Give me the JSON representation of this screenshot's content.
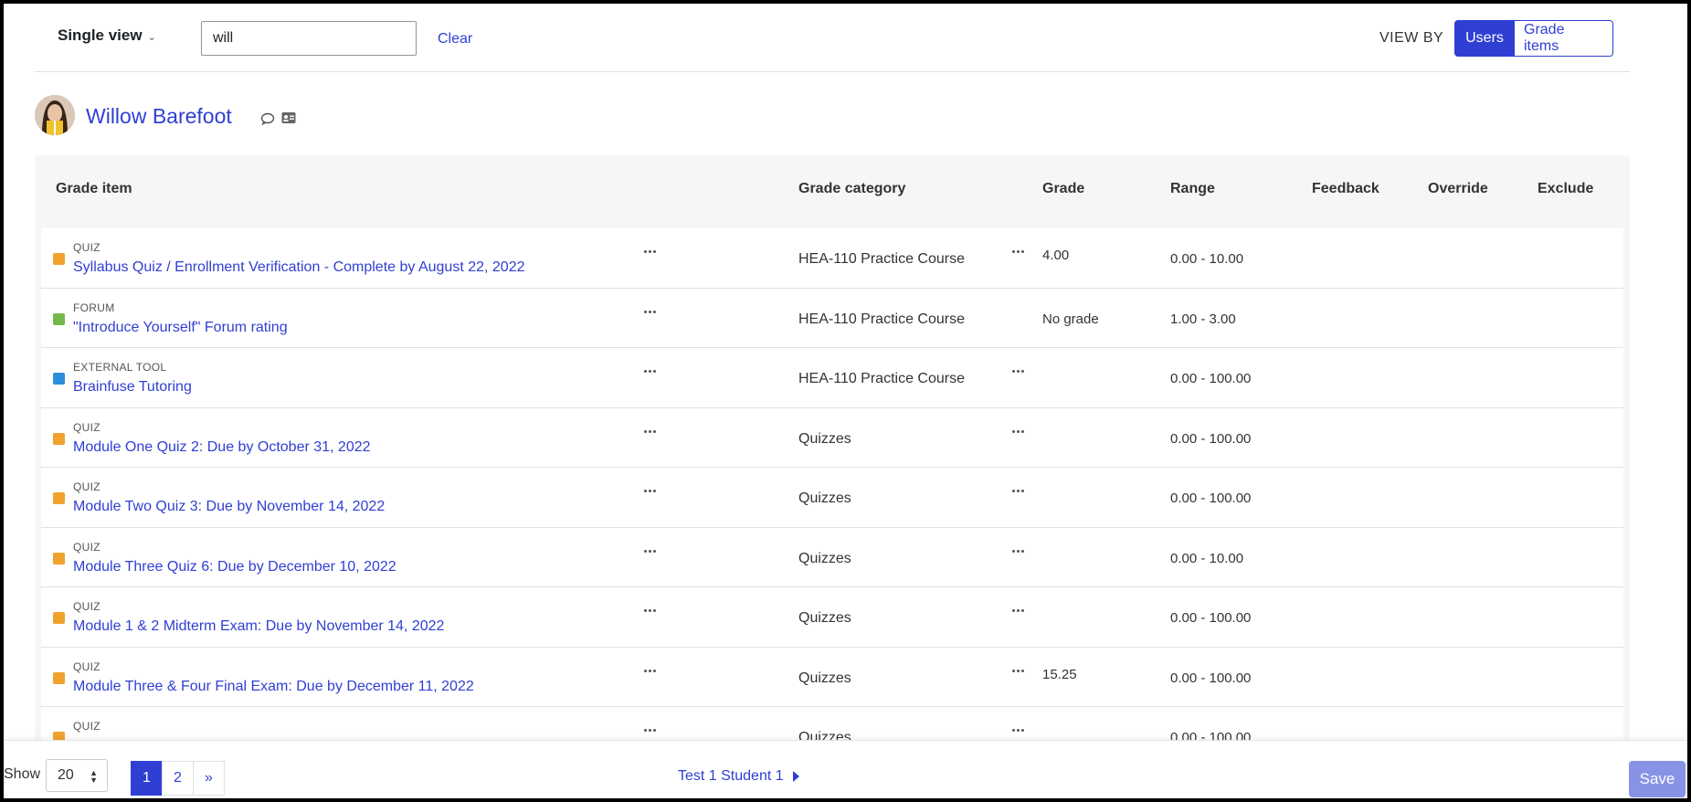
{
  "header": {
    "single_view_label": "Single view",
    "search_value": "will",
    "clear_label": "Clear",
    "view_by_label": "VIEW BY",
    "view_users_label": "Users",
    "view_grade_items_label": "Grade items"
  },
  "user": {
    "name": "Willow Barefoot"
  },
  "table": {
    "columns": [
      "Grade item",
      "Grade category",
      "Grade",
      "Range",
      "Feedback",
      "Override",
      "Exclude"
    ],
    "rows": [
      {
        "type": "QUIZ",
        "icon": "quiz-icon",
        "name": "Syllabus Quiz / Enrollment Verification - Complete by August 22, 2022",
        "category": "HEA-110 Practice Course",
        "grade": "4.00",
        "range": "0.00 - 10.00"
      },
      {
        "type": "FORUM",
        "icon": "forum-icon",
        "name": "\"Introduce Yourself\" Forum rating",
        "category": "HEA-110 Practice Course",
        "grade": "No grade",
        "range": "1.00 - 3.00"
      },
      {
        "type": "EXTERNAL TOOL",
        "icon": "external-tool-icon",
        "name": "Brainfuse Tutoring",
        "category": "HEA-110 Practice Course",
        "grade": "",
        "range": "0.00 - 100.00"
      },
      {
        "type": "QUIZ",
        "icon": "quiz-icon",
        "name": "Module One Quiz 2: Due by October 31, 2022",
        "category": "Quizzes",
        "grade": "",
        "range": "0.00 - 100.00"
      },
      {
        "type": "QUIZ",
        "icon": "quiz-icon",
        "name": "Module Two Quiz 3: Due by November 14, 2022",
        "category": "Quizzes",
        "grade": "",
        "range": "0.00 - 100.00"
      },
      {
        "type": "QUIZ",
        "icon": "quiz-icon",
        "name": "Module Three Quiz 6: Due by December 10, 2022",
        "category": "Quizzes",
        "grade": "",
        "range": "0.00 - 10.00"
      },
      {
        "type": "QUIZ",
        "icon": "quiz-icon",
        "name": "Module 1 & 2 Midterm Exam: Due by November 14, 2022",
        "category": "Quizzes",
        "grade": "",
        "range": "0.00 - 100.00"
      },
      {
        "type": "QUIZ",
        "icon": "quiz-icon",
        "name": "Module Three & Four Final Exam: Due by December 11, 2022",
        "category": "Quizzes",
        "grade": "15.25",
        "range": "0.00 - 100.00"
      },
      {
        "type": "QUIZ",
        "icon": "quiz-icon",
        "name": "",
        "category": "Quizzes",
        "grade": "",
        "range": "0.00 - 100.00"
      }
    ]
  },
  "footer": {
    "show_label": "Show",
    "per_page": "20",
    "pages": [
      "1",
      "2",
      "»"
    ],
    "next_user_label": "Test 1 Student 1",
    "save_label": "Save"
  },
  "colors": {
    "accent": "#2f3fd3",
    "quiz_icon": "#f0a22e",
    "forum_icon": "#76b84c",
    "external_icon": "#2b8fd9"
  }
}
